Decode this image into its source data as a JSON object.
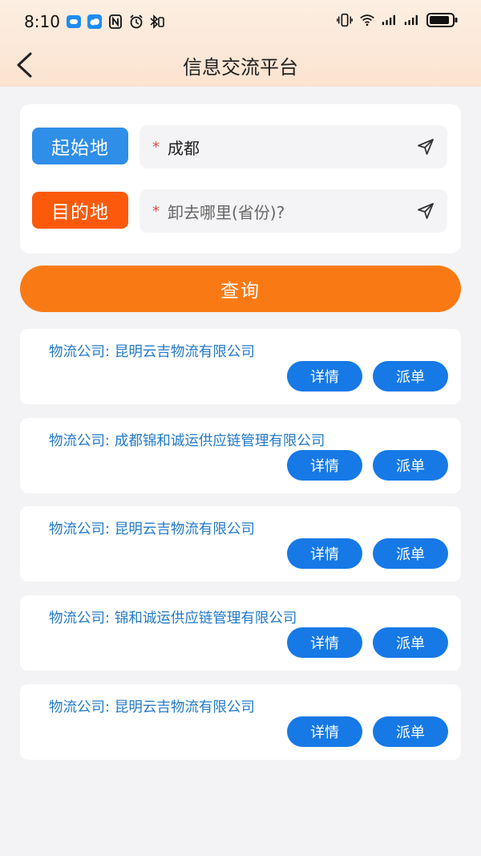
{
  "status_bar": {
    "time": "8:10",
    "left_icons": [
      "chat-bubble-icon",
      "cloud-app-icon",
      "nfc-icon",
      "alarm-icon",
      "bluetooth-icon"
    ],
    "right_icons": [
      "vibrate-icon",
      "wifi-icon",
      "signal-icon",
      "signal-icon-2",
      "battery-icon"
    ]
  },
  "nav": {
    "back_icon": "chevron-left-icon",
    "title": "信息交流平台"
  },
  "search": {
    "origin_tag": "起始地",
    "origin_required": "*",
    "origin_value": "成都",
    "destination_tag": "目的地",
    "destination_required": "*",
    "destination_placeholder": "卸去哪里(省份)?",
    "location_icon": "send-arrow-icon",
    "colors": {
      "origin_tag": "#2f8ee8",
      "destination_tag": "#fc5a0a"
    }
  },
  "query_button": {
    "label": "查询",
    "color": "#f97a14"
  },
  "results": {
    "company_label": "物流公司:",
    "detail_label": "详情",
    "dispatch_label": "派单",
    "items": [
      {
        "company": "昆明云吉物流有限公司"
      },
      {
        "company": "成都锦和诚运供应链管理有限公司"
      },
      {
        "company": "昆明云吉物流有限公司"
      },
      {
        "company": "锦和诚运供应链管理有限公司"
      },
      {
        "company": "昆明云吉物流有限公司"
      }
    ],
    "button_color": "#1679e6",
    "text_color": "#2279c8"
  }
}
